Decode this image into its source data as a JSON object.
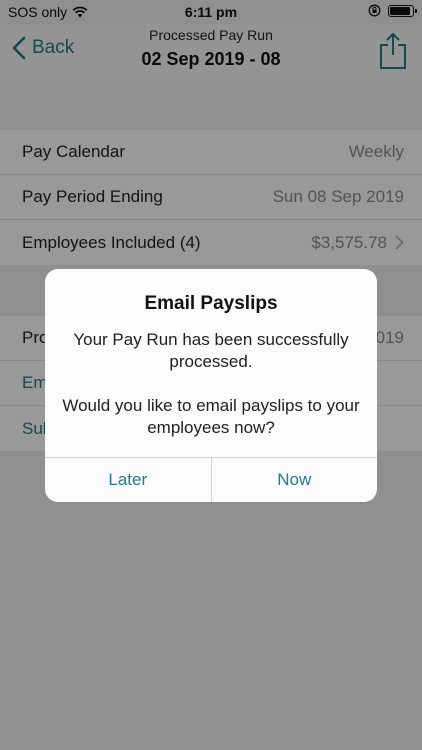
{
  "status_bar": {
    "carrier": "SOS only",
    "time": "6:11 pm",
    "battery_level": 0.9
  },
  "nav": {
    "back_label": "Back",
    "subtitle": "Processed Pay Run",
    "title": "02 Sep 2019 - 08"
  },
  "details": {
    "pay_calendar_label": "Pay Calendar",
    "pay_calendar_value": "Weekly",
    "pay_period_label": "Pay Period Ending",
    "pay_period_value": "Sun 08 Sep 2019",
    "employees_label": "Employees Included (4)",
    "employees_value": "$3,575.78"
  },
  "actions": {
    "processed_label": "Pro",
    "processed_value": "019",
    "email_label": "Em",
    "submit_label": "Sub"
  },
  "dialog": {
    "title": "Email Payslips",
    "message_line1": "Your Pay Run has been successfully processed.",
    "message_line2": "Would you like to email payslips to your employees now?",
    "later_label": "Later",
    "now_label": "Now"
  },
  "colors": {
    "accent": "#1e7b8c",
    "overlay": "rgba(0,0,0,0.40)"
  },
  "icons": {
    "wifi": "wifi-icon",
    "lock_rotation": "lock-rotation-icon",
    "battery": "battery-icon",
    "back": "chevron-left-icon",
    "share": "share-icon",
    "disclosure": "chevron-right-icon"
  }
}
